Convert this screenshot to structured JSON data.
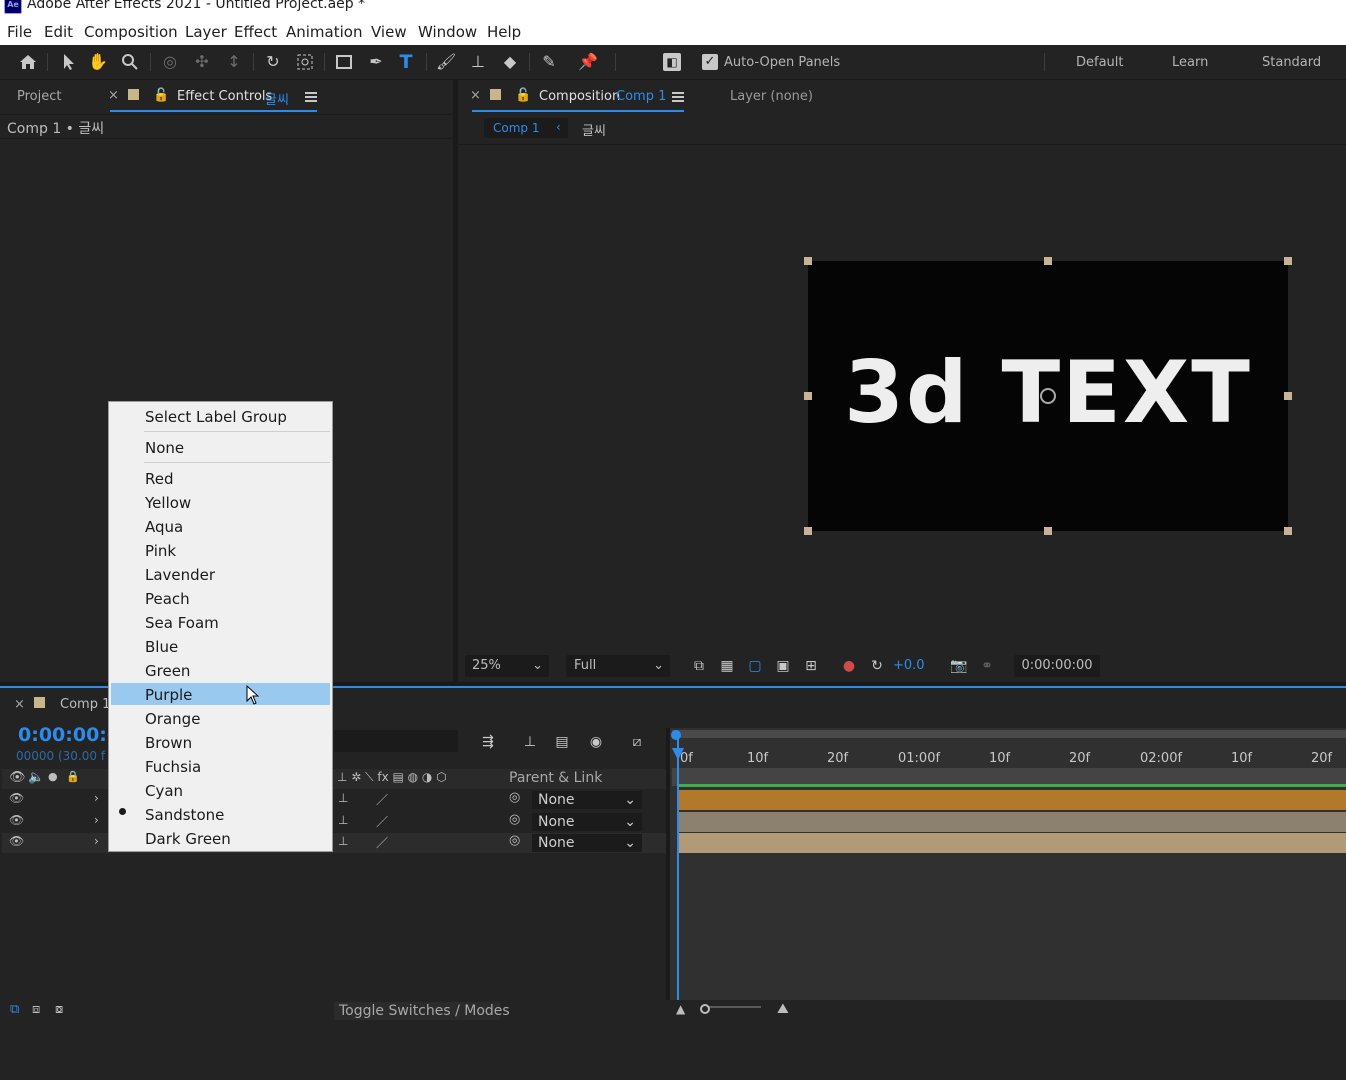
{
  "app": {
    "title": "Adobe After Effects 2021 - Untitled Project.aep *",
    "logo_text": "Ae"
  },
  "menu": [
    "File",
    "Edit",
    "Composition",
    "Layer",
    "Effect",
    "Animation",
    "View",
    "Window",
    "Help"
  ],
  "toolbar": {
    "tools": [
      "home-icon",
      "selection-arrow-icon",
      "hand-icon",
      "zoom-icon",
      "orbit-camera-icon",
      "pan-camera-icon",
      "dolly-camera-icon",
      "rotate-icon",
      "anchor-point-icon",
      "rectangle-icon",
      "pen-icon",
      "type-icon",
      "brush-icon",
      "clone-stamp-icon",
      "eraser-icon",
      "roto-brush-icon",
      "puppet-pin-icon"
    ],
    "auto_open_label": "Auto-Open Panels",
    "auto_open_checked": true,
    "workspaces": [
      "Default",
      "Learn",
      "Standard"
    ]
  },
  "left_panel": {
    "tab_project": "Project",
    "tab_effect_controls": "Effect Controls",
    "effect_layer": "글씨",
    "breadcrumb": "Comp 1 • 글씨"
  },
  "viewer": {
    "tab_label": "Composition",
    "tab_comp": "Comp 1",
    "layer_tab": "Layer (none)",
    "nav_comp": "Comp 1",
    "nav_layer": "글씨",
    "comp_text": "3d TEXT",
    "zoom": "25%",
    "resolution": "Full",
    "exposure": "+0.0",
    "timecode": "0:00:00:00"
  },
  "timeline": {
    "tab": "Comp 1",
    "current_time": "0:00:00:0",
    "frame_info": "00000 (30.00 f",
    "parent_header": "Parent & Link",
    "rows": [
      {
        "parent": "None",
        "bar_color": "#b3792a"
      },
      {
        "parent": "None",
        "bar_color": "#8c806f"
      },
      {
        "parent": "None",
        "bar_color": "#b09a77"
      }
    ],
    "ruler": [
      "0f",
      "10f",
      "20f",
      "01:00f",
      "10f",
      "20f",
      "02:00f",
      "10f",
      "20f"
    ],
    "toggle_label": "Toggle Switches / Modes"
  },
  "context_menu": {
    "header": "Select Label Group",
    "none": "None",
    "colors": [
      "Red",
      "Yellow",
      "Aqua",
      "Pink",
      "Lavender",
      "Peach",
      "Sea Foam",
      "Blue",
      "Green",
      "Purple",
      "Orange",
      "Brown",
      "Fuchsia",
      "Cyan",
      "Sandstone",
      "Dark Green"
    ],
    "highlighted": "Purple",
    "checked": "Sandstone"
  }
}
